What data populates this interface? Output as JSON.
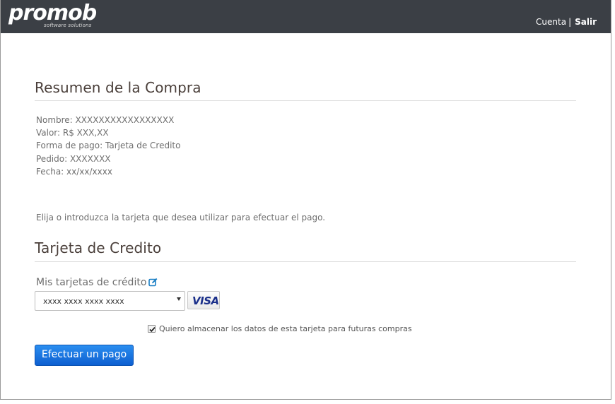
{
  "header": {
    "logo_text": "promob",
    "logo_tagline": "software solutions",
    "account_link": "Cuenta",
    "separator": "|",
    "logout_link": "Salir"
  },
  "summary": {
    "title": "Resumen de la Compra",
    "lines": [
      "Nombre: XXXXXXXXXXXXXXXXX",
      "Valor: R$ XXX,XX",
      "Forma de pago: Tarjeta de Credito",
      "Pedido: XXXXXXX",
      "Fecha: xx/xx/xxxx"
    ]
  },
  "instructions": "Elija o introduzca la tarjeta que desea utilizar para efectuar el pago.",
  "card_section": {
    "title": "Tarjeta de Credito",
    "cards_label": "Mis tarjetas de crédito",
    "selected_card": "xxxx xxxx xxxx xxxx",
    "card_brand": "VISA",
    "save_checkbox_label": "Quiero almacenar los datos de esta tarjeta para futuras compras",
    "save_checkbox_checked": true,
    "pay_button": "Efectuar un pago"
  },
  "colors": {
    "header_bg": "#3b3f45",
    "heading_text": "#4a3f3a",
    "button_top": "#2b8ef0",
    "button_bottom": "#0d5fd0",
    "visa_blue": "#1a2f8a",
    "edit_icon": "#1b7fc4"
  },
  "icons": {
    "edit": "edit-icon",
    "dropdown": "chevron-down-icon",
    "checkbox": "checkmark-icon"
  }
}
